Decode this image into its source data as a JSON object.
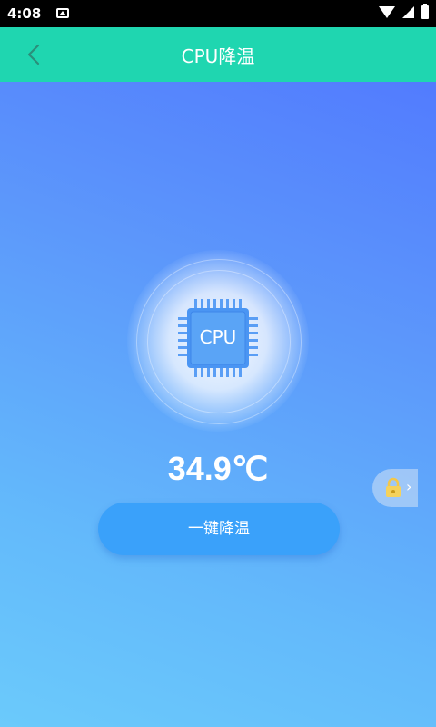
{
  "status_bar": {
    "time": "4:08"
  },
  "app_bar": {
    "title": "CPU降温",
    "back_icon": "chevron-left-icon"
  },
  "cpu": {
    "chip_label": "CPU",
    "temperature": "34.9℃"
  },
  "actions": {
    "cool_button_label": "一键降温"
  },
  "float_widget": {
    "icon": "lock-icon",
    "arrow": "›"
  },
  "colors": {
    "app_bar": "#1fd6b0",
    "button": "#3aa1fa",
    "bg_top": "#4f73ff",
    "bg_bottom": "#6bcafb"
  }
}
